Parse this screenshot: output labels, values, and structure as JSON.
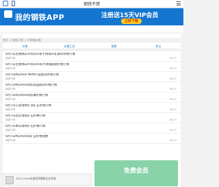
{
  "header": {
    "title": "钢铁不锈"
  },
  "banner": {
    "app_name": "我的钢铁APP",
    "promo": "注册送15天VIP会员",
    "cta": "立即下载"
  },
  "subnav": {
    "items": [
      "不锈钢",
      "钢材",
      "原料",
      "价格",
      "更多"
    ]
  },
  "breadcrumb": "首页 > 钢铁不锈 > 不锈钢价格",
  "tabs": [
    "价格",
    "价格汇总",
    "指数",
    "热点"
  ],
  "articles": [
    {
      "title": "6月7日无锡佛山市场304系不锈钢冷轧钢带价格行情",
      "source": "钢铁不锈",
      "date": "06-07"
    },
    {
      "title": "6月7日无锡佛山市场304系不锈钢圆钢价格行情",
      "source": "钢铁不锈",
      "date": "06-07"
    },
    {
      "title": "6月7日Mysteel NRM产品期货价格行情",
      "source": "钢铁不锈",
      "date": "06-07"
    },
    {
      "title": "6月7日Mysteel高铁铁品期货价格行情",
      "source": "钢铁不锈",
      "date": "06-07"
    },
    {
      "title": "6月7日Mysteel高铁镍价格行情",
      "source": "钢铁不锈",
      "date": "06-07"
    },
    {
      "title": "6月7日宁波港原矿铁矿石价格行情",
      "source": "钢铁不锈",
      "date": "06-07"
    },
    {
      "title": "6月7日连云港铁矿石价格行情",
      "source": "钢铁不锈",
      "date": "06-07"
    },
    {
      "title": "6月7日青岛港铁矿石价格行情",
      "source": "钢铁不锈",
      "date": "06-07"
    },
    {
      "title": "6月7日Mysteel铁矿石价格指数",
      "source": "钢铁不锈",
      "date": "06-07"
    }
  ],
  "overlay": {
    "text": "免费会员"
  },
  "ad": {
    "text": "2023-2024年度优质钢铁企业评选"
  }
}
